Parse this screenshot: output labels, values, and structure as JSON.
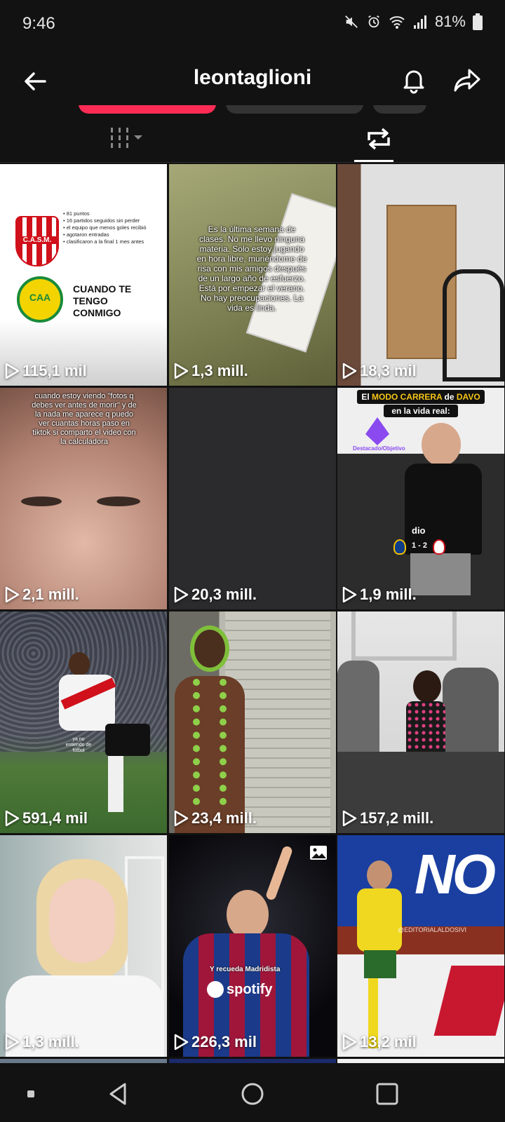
{
  "status_bar": {
    "time": "9:46",
    "battery": "81%",
    "icons": [
      "mute-icon",
      "alarm-icon",
      "wifi-icon",
      "signal-icon",
      "battery-icon"
    ]
  },
  "header": {
    "username": "leontaglioni",
    "back_icon": "arrow-left-icon",
    "bell_icon": "bell-icon",
    "share_icon": "share-arrow-icon"
  },
  "tabs": [
    {
      "name": "videos-grid",
      "icon": "grid-bars-icon"
    },
    {
      "name": "reposts",
      "icon": "repost-icon",
      "active": true
    }
  ],
  "videos": [
    {
      "views": "115,1 mil",
      "overlay_lines": [
        "• 81 puntos",
        "• 16 partidos seguidos sin perder",
        "• el equipo que menos goles recibió",
        "• agotaron entradas",
        "• clasificaron a la final 1 mes antes"
      ],
      "logo_top": "C.A.S.M.",
      "logo_bottom": "CAA",
      "caption": "CUANDO TE TENGO CONMIGO"
    },
    {
      "views": "1,3 mill.",
      "overlay": "Es la última semana de clases. No me llevo ninguna materia. Solo estoy jugando en hora libre, muriéndome de risa con mis amigos después de un largo año de esfuerzo. Está por empezar el verano. No hay preocupaciones. La vida es linda."
    },
    {
      "views": "18,3 mil"
    },
    {
      "views": "2,1 mill.",
      "overlay": "cuando estoy viendo \"fotos q debes ver antes de morir\" y de la nada me aparece q puedo ver cuantas horas paso en tiktok si comparto el video con la calculadora"
    },
    {
      "views": "20,3 mill."
    },
    {
      "views": "1,9 mill.",
      "caption_prefix": "El ",
      "caption_highlight1": "MODO CARRERA",
      "caption_mid": " de ",
      "caption_highlight2": "DAVO",
      "caption_line2": "en la vida real:",
      "badge": "Destacado/Objetivo",
      "score_label": "dio",
      "score": "1 - 2"
    },
    {
      "views": "591,4 mil",
      "small_caption": "ya no entiendo de fútbol"
    },
    {
      "views": "23,4 mill."
    },
    {
      "views": "157,2 mill."
    },
    {
      "views": "1,3 mill."
    },
    {
      "views": "226,3 mil",
      "caption": "Y recueda Madridista",
      "brand": "spotify",
      "photo_icon": "image-icon"
    },
    {
      "views": "13,2 mil",
      "watermark": "@EDITORIALALDOSIVI",
      "banner": "NO"
    }
  ],
  "nav": {
    "recent": "recent-apps-icon",
    "back": "nav-back-icon",
    "home": "nav-home-icon",
    "extra": "nav-dot-icon"
  }
}
